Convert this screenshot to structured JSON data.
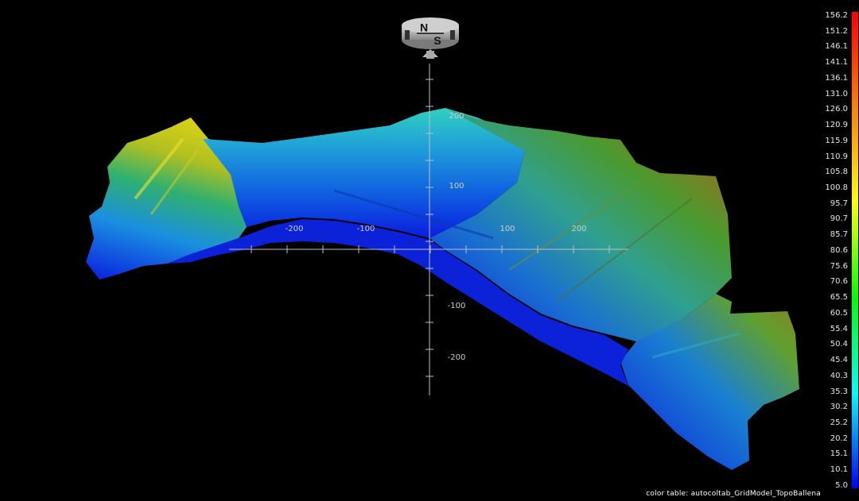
{
  "compass": {
    "north": "N",
    "south": "S"
  },
  "axis": {
    "x_labels": [
      "-200",
      "-100",
      "100",
      "200"
    ],
    "y_labels": [
      "200",
      "100",
      "-100",
      "-200"
    ]
  },
  "color_scale": {
    "labels": [
      "156.2",
      "151.2",
      "146.1",
      "141.1",
      "136.1",
      "131.0",
      "126.0",
      "120.9",
      "115.9",
      "110.9",
      "105.8",
      "100.8",
      "95.7",
      "90.7",
      "85.7",
      "80.6",
      "75.6",
      "70.6",
      "65.5",
      "60.5",
      "55.4",
      "50.4",
      "45.4",
      "40.3",
      "35.3",
      "30.2",
      "25.2",
      "20.2",
      "15.1",
      "10.1",
      "5.0"
    ],
    "colors": [
      "#ff0000",
      "#ff4000",
      "#ff8000",
      "#ffbf00",
      "#ffff00",
      "#80ff00",
      "#00ff00",
      "#00ff80",
      "#00ffff",
      "#0080ff",
      "#0000ff"
    ]
  },
  "footer": {
    "color_table": "color table: autocoltab_GridModel_TopoBallena"
  },
  "surface_colors": {
    "deep": "#0a1de0",
    "shallow": "#1aa0e0",
    "mid": "#2fd0a0",
    "green": "#40b040",
    "yellow": "#c8c820",
    "olive": "#8a7a20",
    "brown": "#a04010"
  }
}
